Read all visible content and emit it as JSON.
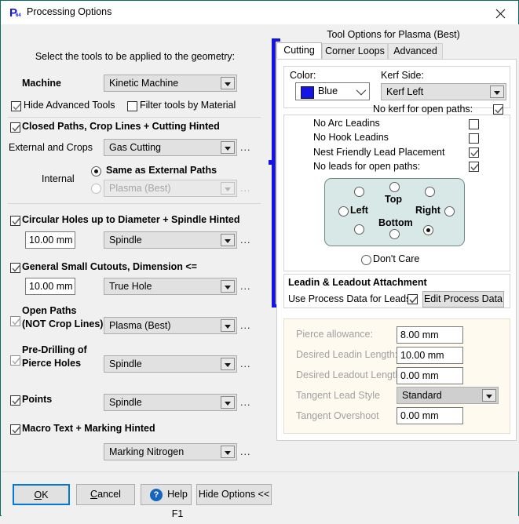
{
  "window": {
    "title": "Processing Options",
    "icon": "app-p64-icon",
    "close_label": "✕"
  },
  "left": {
    "instruction": "Select the tools to be applied to the geometry:",
    "machine_label": "Machine",
    "machine_value": "Kinetic Machine",
    "hide_advanced_tools": "Hide Advanced Tools",
    "filter_tools_by_material": "Filter tools by Material",
    "closed_paths_header": "Closed Paths,  Crop Lines  +   Cutting Hinted",
    "external_and_crops_label": "External and Crops",
    "external_and_crops_value": "Gas Cutting",
    "internal_label": "Internal",
    "internal_same_as_external": "Same as External Paths",
    "internal_other_value": "Plasma (Best)",
    "circular_holes_header": "Circular Holes up to Diameter   +  Spindle Hinted",
    "circular_holes_dim": "10.00 mm",
    "circular_holes_tool": "Spindle",
    "small_cutouts_header": "General Small Cutouts, Dimension <=",
    "small_cutouts_dim": "10.00 mm",
    "small_cutouts_tool": "True Hole",
    "open_paths_header_1": "Open Paths",
    "open_paths_header_2": "(NOT Crop Lines)",
    "open_paths_tool": "Plasma (Best)",
    "predrill_header_1": "Pre-Drilling of",
    "predrill_header_2": "Pierce Holes",
    "predrill_tool": "Spindle",
    "points_header": "Points",
    "points_tool": "Spindle",
    "macro_text_header": "Macro Text  +  Marking Hinted",
    "macro_text_tool": "Marking Nitrogen",
    "ellipsis": "..."
  },
  "right": {
    "panel_title": "Tool Options for Plasma (Best)",
    "tabs": [
      {
        "label": "Cutting",
        "selected": true
      },
      {
        "label": "Corner Loops",
        "selected": false
      },
      {
        "label": "Advanced",
        "selected": false
      }
    ],
    "color_label": "Color:",
    "color_value": "Blue",
    "color_hex": "#1414e6",
    "kerf_side_label": "Kerf Side:",
    "kerf_side_value": "Kerf Left",
    "no_kerf_open_paths": "No kerf for open paths:",
    "options": [
      {
        "label": "No Arc Leadins",
        "checked": false
      },
      {
        "label": "No Hook Leadins",
        "checked": false
      },
      {
        "label": "Nest Friendly Lead Placement",
        "checked": true
      },
      {
        "label": "No leads for open paths:",
        "checked": true
      }
    ],
    "lead_grid": {
      "top": "Top",
      "bottom": "Bottom",
      "left": "Left",
      "right": "Right",
      "selected": "bottom-right"
    },
    "dont_care": "Don't Care",
    "leadin_section_title": "Leadin & Leadout Attachment",
    "use_process_data": "Use Process Data for Leads",
    "use_process_data_checked": true,
    "edit_process_data": "Edit Process Data",
    "fields": [
      {
        "label": "Pierce allowance:",
        "value": "8.00 mm"
      },
      {
        "label": "Desired Leadin Length:",
        "value": "10.00 mm"
      },
      {
        "label": "Desired Leadout Length:",
        "value": "0.00 mm"
      },
      {
        "label": "Tangent Lead Style",
        "value": "Standard"
      },
      {
        "label": "Tangent Overshoot",
        "value": "0.00 mm"
      }
    ]
  },
  "footer": {
    "ok": "OK",
    "cancel": "Cancel",
    "help": "Help F1",
    "help_icon_glyph": "?",
    "hide_options": "Hide Options <<"
  }
}
